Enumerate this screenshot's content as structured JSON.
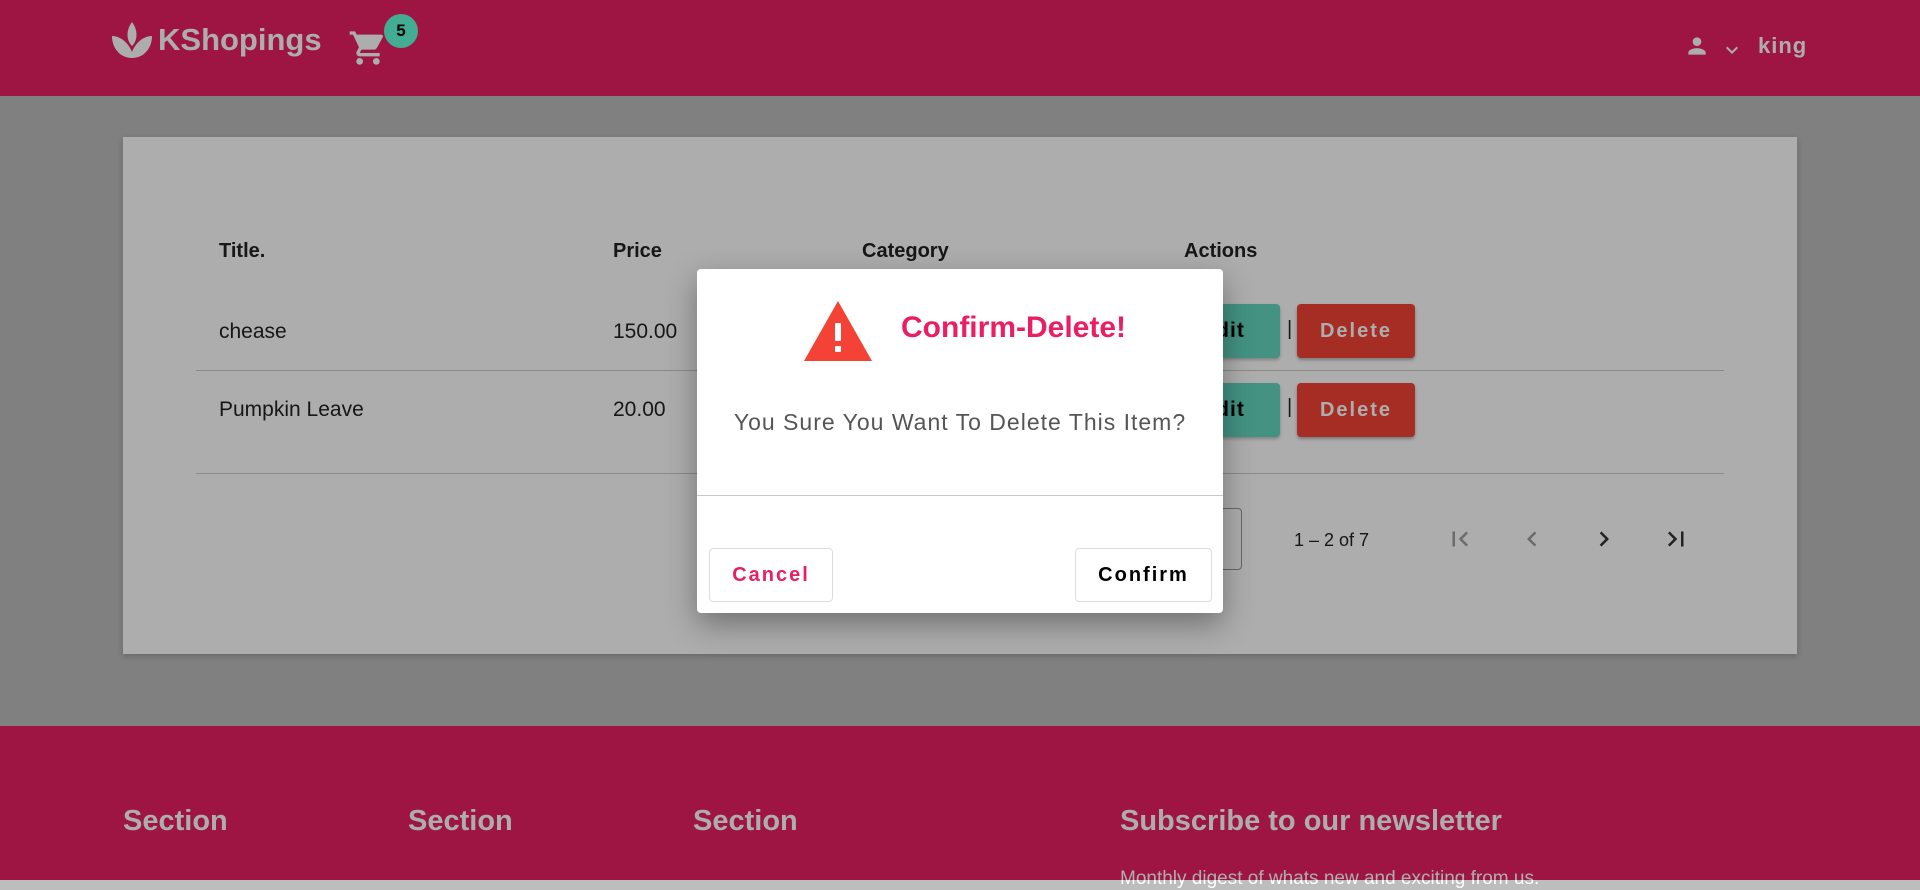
{
  "brand": {
    "name": "KShopings"
  },
  "header": {
    "cart_count": "5",
    "username": "king"
  },
  "table": {
    "columns": [
      "Title.",
      "Price",
      "Category",
      "Actions"
    ],
    "rows": [
      {
        "title": "chease",
        "price": "150.00",
        "edit_label": "Edit",
        "separator": "|",
        "delete_label": "Delete"
      },
      {
        "title": "Pumpkin Leave",
        "price": "20.00",
        "edit_label": "Edit",
        "separator": "|",
        "delete_label": "Delete"
      }
    ]
  },
  "pagination": {
    "range": "1 – 2 of 7"
  },
  "footer": {
    "sections": [
      "Section",
      "Section",
      "Section"
    ],
    "newsletter_title": "Subscribe to our newsletter",
    "newsletter_text": "Monthly digest of whats new and exciting from us."
  },
  "dialog": {
    "title": "Confirm-Delete!",
    "message": "You Sure You Want To Delete This Item?",
    "cancel_label": "Cancel",
    "confirm_label": "Confirm"
  },
  "colors": {
    "primary": "#e91e63",
    "accent": "#64ffda",
    "warn": "#f44336",
    "edit": "#64d8c0"
  },
  "icons": [
    "lotus-logo-icon",
    "cart-icon",
    "person-icon",
    "chevron-down-icon",
    "warning-icon",
    "first-page-icon",
    "prev-page-icon",
    "next-page-icon",
    "last-page-icon"
  ]
}
